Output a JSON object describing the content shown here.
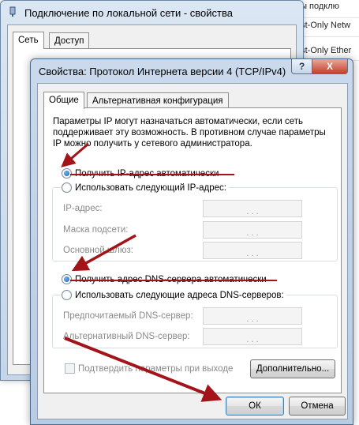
{
  "background_list": {
    "items": [
      "ost-Only Netw",
      "ost-Only Ether",
      "ы подключение"
    ],
    "top_text": "ны подклю"
  },
  "back_window": {
    "title": "Подключение по локальной сети - свойства",
    "tabs": [
      "Сеть",
      "Доступ"
    ]
  },
  "dialog": {
    "title": "Свойства: Протокол Интернета версии 4 (TCP/IPv4)",
    "help_label": "?",
    "close_label": "X",
    "tabs": [
      "Общие",
      "Альтернативная конфигурация"
    ],
    "description": "Параметры IP могут назначаться автоматически, если сеть поддерживает эту возможность. В противном случае параметры IP можно получить у сетевого администратора.",
    "ip_auto": "Получить IP-адрес автоматически",
    "ip_manual": "Использовать следующий IP-адрес:",
    "ip_fields": [
      "IP-адрес:",
      "Маска подсети:",
      "Основной шлюз:"
    ],
    "dns_auto": "Получить адрес DNS-сервера автоматически",
    "dns_manual": "Использовать следующие адреса DNS-серверов:",
    "dns_fields": [
      "Предпочитаемый DNS-сервер:",
      "Альтернативный DNS-сервер:"
    ],
    "validate_label": "Подтвердить параметры при выходе",
    "advanced_button": "Дополнительно...",
    "ok_button": "ОК",
    "cancel_button": "Отмена",
    "ip_dots": ".       .       ."
  },
  "colors": {
    "annotation": "#a2141a",
    "accent": "#1a5fb4"
  }
}
